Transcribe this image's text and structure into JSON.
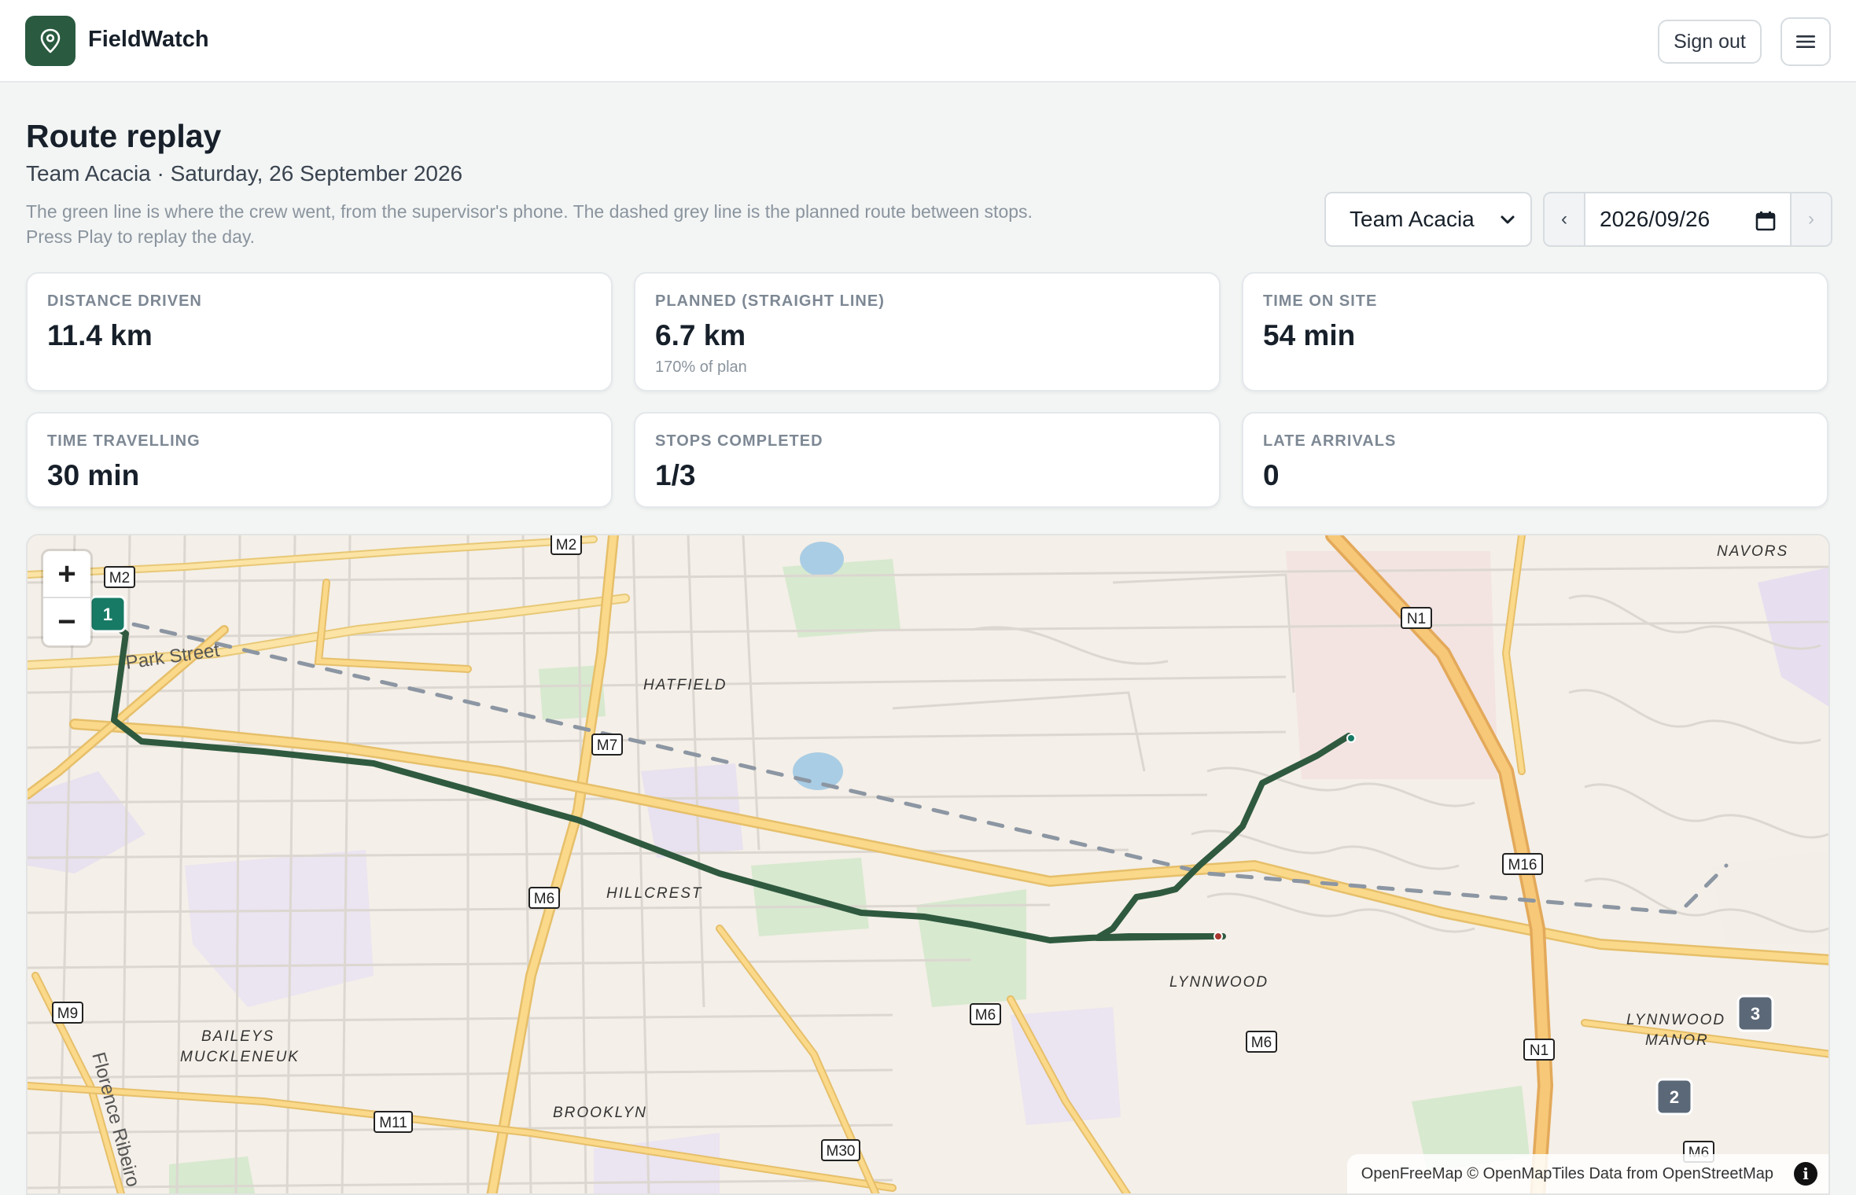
{
  "app": {
    "name": "FieldWatch",
    "sign_out_label": "Sign out"
  },
  "page": {
    "title": "Route replay",
    "subtitle": "Team Acacia · Saturday, 26 September 2026",
    "description_line1": "The green line is where the crew went, from the supervisor's phone. The dashed grey line is the planned route between stops.",
    "description_line2": "Press Play to replay the day."
  },
  "filters": {
    "team_selected": "Team Acacia",
    "date_value": "2026/09/26",
    "prev_label": "‹",
    "next_label": "›"
  },
  "stats": [
    {
      "label": "Distance driven",
      "value": "11.4 km",
      "note": ""
    },
    {
      "label": "Planned (straight line)",
      "value": "6.7 km",
      "note": "170% of plan"
    },
    {
      "label": "Time on site",
      "value": "54 min",
      "note": ""
    },
    {
      "label": "Time travelling",
      "value": "30 min",
      "note": ""
    },
    {
      "label": "Stops completed",
      "value": "1/3",
      "note": ""
    },
    {
      "label": "Late arrivals",
      "value": "0",
      "note": ""
    }
  ],
  "map": {
    "zoom_in": "+",
    "zoom_out": "−",
    "stops": [
      "1",
      "2",
      "3"
    ],
    "road_shields": [
      "M2",
      "M2",
      "N1",
      "M7",
      "M16",
      "M6",
      "M6",
      "M6",
      "M9",
      "M11",
      "M30",
      "N1",
      "M6"
    ],
    "area_labels": [
      "NAVORS",
      "HATFIELD",
      "HILLCREST",
      "LYNNWOOD",
      "LYNNWOOD",
      "MANOR",
      "BAILEYS",
      "MUCKLENEUK",
      "BROOKLYN"
    ],
    "street_labels": [
      "Park Street",
      "Florence Ribeiro"
    ],
    "attribution": "OpenFreeMap © OpenMapTiles Data from OpenStreetMap",
    "attribution_info": "i",
    "colors": {
      "actual_route": "#2f5a3f",
      "planned_route": "#8c96a3",
      "stop_done": "#177a64",
      "stop_pending": "#5b6878"
    }
  }
}
